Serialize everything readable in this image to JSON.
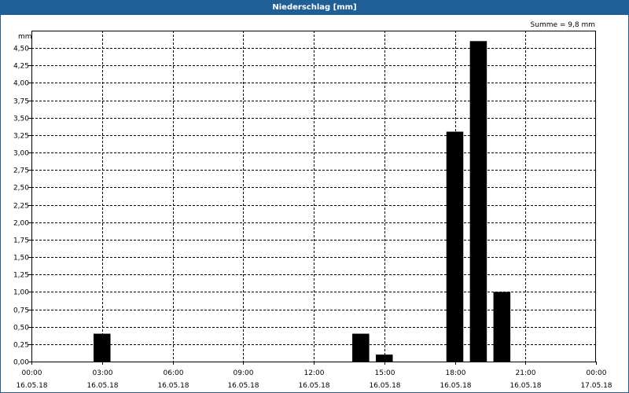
{
  "chart_data": {
    "type": "bar",
    "title": "Niederschlag [mm]",
    "annotation": "Summe = 9,8 mm",
    "ylabel": "mm",
    "ylim": [
      0,
      4.75
    ],
    "yticks": [
      "0,00",
      "0,25",
      "0,50",
      "0,75",
      "1,00",
      "1,25",
      "1,50",
      "1,75",
      "2,00",
      "2,25",
      "2,50",
      "2,75",
      "3,00",
      "3,25",
      "3,50",
      "3,75",
      "4,00",
      "4,25",
      "4,50"
    ],
    "xlim_hours": [
      0,
      24
    ],
    "xticks": [
      {
        "time": "00:00",
        "date": "16.05.18"
      },
      {
        "time": "03:00",
        "date": "16.05.18"
      },
      {
        "time": "06:00",
        "date": "16.05.18"
      },
      {
        "time": "09:00",
        "date": "16.05.18"
      },
      {
        "time": "12:00",
        "date": "16.05.18"
      },
      {
        "time": "15:00",
        "date": "16.05.18"
      },
      {
        "time": "18:00",
        "date": "16.05.18"
      },
      {
        "time": "21:00",
        "date": "16.05.18"
      },
      {
        "time": "00:00",
        "date": "17.05.18"
      }
    ],
    "grid": true,
    "bar_color": "#000000",
    "bars": [
      {
        "time": "03:00",
        "value": 0.4
      },
      {
        "time": "14:00",
        "value": 0.4
      },
      {
        "time": "15:00",
        "value": 0.1
      },
      {
        "time": "18:00",
        "value": 3.3
      },
      {
        "time": "19:00",
        "value": 4.6
      },
      {
        "time": "20:00",
        "value": 1.0
      }
    ]
  }
}
